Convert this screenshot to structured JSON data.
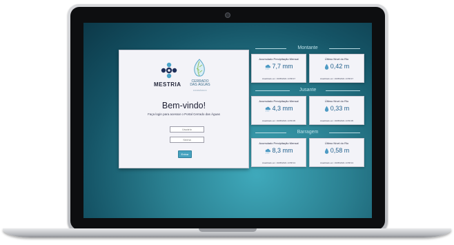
{
  "login": {
    "brand_mestria": "MESTRIA",
    "brand_cerrado_line1": "CERRADO",
    "brand_cerrado_line2": "DAS ÁGUAS",
    "brand_cerrado_sub": "CONSÓRCIO",
    "welcome": "Bem-vindo!",
    "subtitle": "Faça login para acessar o Portal Cerrado das Águas",
    "user_placeholder": "Usuário",
    "password_placeholder": "Senha",
    "enter_label": "Entrar"
  },
  "sections": [
    {
      "title": "Montante",
      "cards": [
        {
          "label": "Acumulado Precipitação Mensal",
          "value": "7,7 mm",
          "icon": "rain-cloud-icon",
          "updated": "Atualizado em: 19/05/2021 13:58:47"
        },
        {
          "label": "Último Nível do Rio",
          "value": "0,42 m",
          "icon": "water-drop-icon",
          "updated": "Atualizado em: 19/05/2021 13:58:47"
        }
      ]
    },
    {
      "title": "Jusante",
      "cards": [
        {
          "label": "Acumulado Precipitação Mensal",
          "value": "4,3 mm",
          "icon": "rain-cloud-icon",
          "updated": "Atualizado em: 19/05/2021 13:56:35"
        },
        {
          "label": "Último Nível do Rio",
          "value": "0,33 m",
          "icon": "water-drop-icon",
          "updated": "Atualizado em: 19/05/2021 13:56:35"
        }
      ]
    },
    {
      "title": "Barragem",
      "cards": [
        {
          "label": "Acumulado Precipitação Mensal",
          "value": "8,3 mm",
          "icon": "rain-cloud-icon",
          "updated": "Atualizado em: 19/05/2021 13:58:13"
        },
        {
          "label": "Último Nível do Rio",
          "value": "0,58 m",
          "icon": "water-drop-icon",
          "updated": "Atualizado em: 19/05/2021 13:58:13"
        }
      ]
    }
  ],
  "colors": {
    "accent": "#46a2bf",
    "value_text": "#1e5e8b",
    "section_title": "#bfe2ea"
  }
}
